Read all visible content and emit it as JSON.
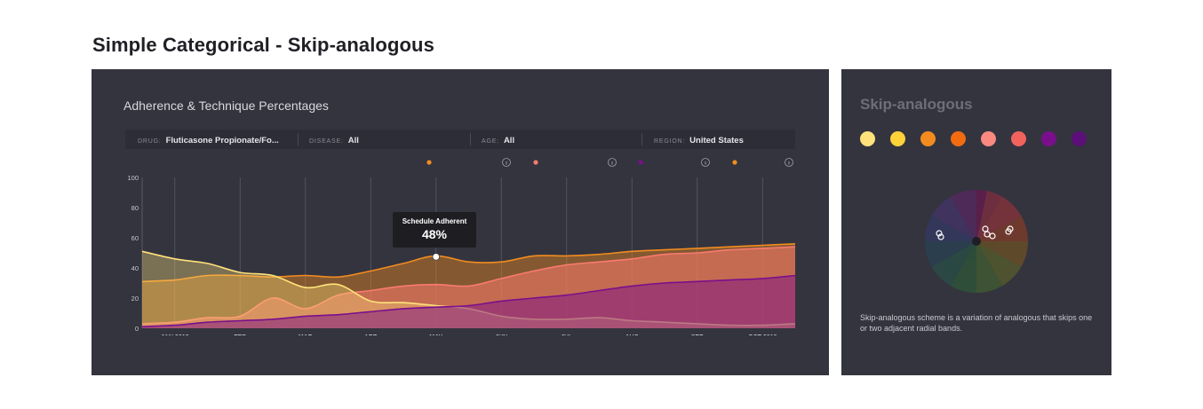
{
  "page": {
    "title": "Simple Categorical - Skip-analogous"
  },
  "chart_panel": {
    "title": "Adherence & Technique Percentages",
    "filters": [
      {
        "label": "DRUG:",
        "value": "Fluticasone Propionate/Fo..."
      },
      {
        "label": "DISEASE:",
        "value": "All"
      },
      {
        "label": "AGE:",
        "value": "All"
      },
      {
        "label": "REGION:",
        "value": "United States"
      }
    ],
    "tooltip": {
      "label": "Schedule Adherent",
      "value": "48%"
    }
  },
  "chart_data": {
    "type": "area",
    "title": "Adherence & Technique Percentages",
    "xlabel": "",
    "ylabel": "",
    "ylim": [
      0,
      100
    ],
    "yticks": [
      0,
      20,
      40,
      60,
      80,
      100
    ],
    "xlim": [
      0,
      10
    ],
    "categories": [
      "JAN 2018",
      "FEB",
      "MAR",
      "APR",
      "MAY",
      "JUN",
      "JUL",
      "AUG",
      "SEP",
      "OCT 2018"
    ],
    "x": [
      0,
      0.5,
      1,
      1.5,
      2,
      2.5,
      3,
      3.5,
      4,
      4.5,
      5,
      5.5,
      6,
      6.5,
      7,
      7.5,
      8,
      8.5,
      9,
      9.5,
      10
    ],
    "grid": true,
    "series": [
      {
        "color": "#f28c1f",
        "values": [
          31,
          32,
          35,
          35,
          34,
          35,
          34,
          38,
          43,
          48,
          44,
          44,
          48,
          48,
          49,
          51,
          52,
          53,
          54,
          55,
          56
        ]
      },
      {
        "color": "#fa7a6e",
        "values": [
          3,
          4,
          7,
          8,
          20,
          13,
          22,
          25,
          28,
          29,
          28,
          33,
          38,
          42,
          44,
          46,
          49,
          50,
          52,
          53,
          54
        ]
      },
      {
        "color": "#ffe27a",
        "values": [
          51,
          46,
          43,
          37,
          35,
          27,
          29,
          18,
          17,
          15,
          13,
          8,
          6,
          6,
          7,
          5,
          4,
          3,
          2,
          2,
          3
        ]
      },
      {
        "color": "#7a0f8c",
        "values": [
          1,
          2,
          4,
          5,
          6,
          8,
          9,
          11,
          13,
          14,
          15,
          18,
          20,
          22,
          25,
          28,
          30,
          31,
          32,
          33,
          35
        ]
      }
    ]
  },
  "scheme_panel": {
    "title": "Skip-analogous",
    "colors": [
      "#ffe27a",
      "#ffd23a",
      "#f28c1f",
      "#f26b0f",
      "#fa8a80",
      "#f2635e",
      "#7a0f8c",
      "#5b0f78"
    ],
    "description": "Skip-analogous scheme is a variation of analogous that skips one or two adjacent radial bands."
  },
  "icons": {
    "info": "info-circle-icon",
    "cursor": "hand-pointer-icon"
  }
}
